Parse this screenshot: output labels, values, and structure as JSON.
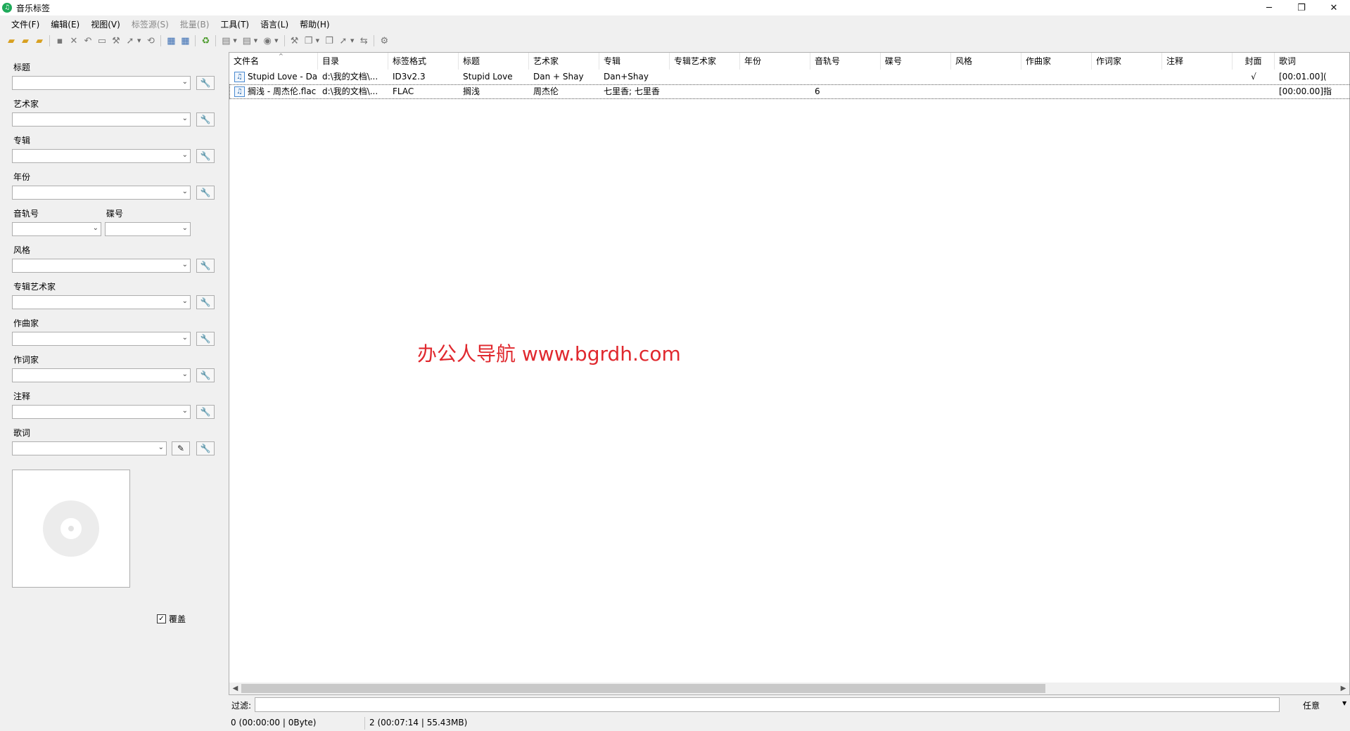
{
  "window": {
    "title": "音乐标签",
    "app_icon_glyph": "♫",
    "minimize": "─",
    "maximize": "❐",
    "close": "✕"
  },
  "menu": [
    "文件(F)",
    "编辑(E)",
    "视图(V)",
    "标签源(S)",
    "批量(B)",
    "工具(T)",
    "语言(L)",
    "帮助(H)"
  ],
  "menu_disabled": [
    3,
    4
  ],
  "fields": {
    "title_label": "标题",
    "artist_label": "艺术家",
    "album_label": "专辑",
    "year_label": "年份",
    "track_label": "音轨号",
    "disc_label": "碟号",
    "genre_label": "风格",
    "album_artist_label": "专辑艺术家",
    "composer_label": "作曲家",
    "lyricist_label": "作词家",
    "comment_label": "注释",
    "lyrics_label": "歌词",
    "overwrite_label": "覆盖",
    "overwrite_checked": true
  },
  "icons": {
    "dropdown": "chevron-down-icon",
    "tool": "wrench-icon",
    "edit": "edit-icon",
    "cover": "disc-placeholder-icon",
    "file": "music-file-icon"
  },
  "columns": [
    "文件名",
    "目录",
    "标签格式",
    "标题",
    "艺术家",
    "专辑",
    "专辑艺术家",
    "年份",
    "音轨号",
    "碟号",
    "风格",
    "作曲家",
    "作词家",
    "注释",
    "封面",
    "歌词"
  ],
  "rows": [
    {
      "filename": "Stupid Love - Dan +...",
      "directory": "d:\\我的文档\\...",
      "format": "ID3v2.3",
      "title": "Stupid Love",
      "artist": "Dan + Shay",
      "album": "Dan+Shay",
      "album_artist": "",
      "year": "",
      "track": "",
      "disc": "",
      "genre": "",
      "composer": "",
      "lyricist": "",
      "comment": "",
      "cover": "√",
      "lyrics": "[00:01.00]("
    },
    {
      "filename": "搁浅 - 周杰伦.flac",
      "directory": "d:\\我的文档\\...",
      "format": "FLAC",
      "title": "搁浅",
      "artist": "周杰伦",
      "album": "七里香; 七里香",
      "album_artist": "",
      "year": "",
      "track": "6",
      "disc": "",
      "genre": "",
      "composer": "",
      "lyricist": "",
      "comment": "",
      "cover": "",
      "lyrics": "[00:00.00]指"
    }
  ],
  "watermark": "办公人导航 www.bgrdh.com",
  "filter": {
    "label": "过滤:",
    "value": "",
    "mode": "任意"
  },
  "status": {
    "selected": "0 (00:00:00 | 0Byte)",
    "total": "2 (00:07:14 | 55.43MB)"
  }
}
